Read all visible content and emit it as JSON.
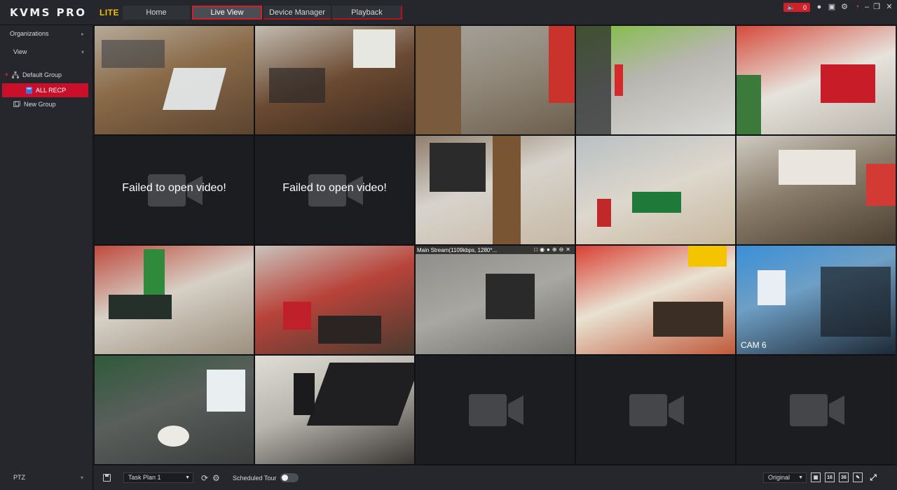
{
  "app": {
    "logo": "KVMS PRO",
    "edition": "LITE"
  },
  "tabs": [
    {
      "label": "Home"
    },
    {
      "label": "Live View"
    },
    {
      "label": "Device Manager"
    },
    {
      "label": "Playback"
    }
  ],
  "alarm_count": "0",
  "sidebar": {
    "organizations_label": "Organizations",
    "view_label": "View",
    "tree": {
      "default_group": "Default Group",
      "selected_item": "ALL RECP",
      "new_group": "New Group"
    },
    "ptz_label": "PTZ"
  },
  "grid": {
    "failed_message": "Failed to open video!",
    "stream_info": "Main Stream(1109kbps, 1280*...",
    "cam6_name": "CAM 6"
  },
  "toolbar": {
    "task_plan": "Task Plan 1",
    "scheduled_tour_label": "Scheduled Tour",
    "scheduled_tour_on": false,
    "view_mode": "Original",
    "layout_16": "16",
    "layout_36": "36"
  },
  "colors": {
    "accent": "#d0202a",
    "edition": "#f5c000",
    "background": "#1c1e22",
    "panel": "#25272c"
  }
}
